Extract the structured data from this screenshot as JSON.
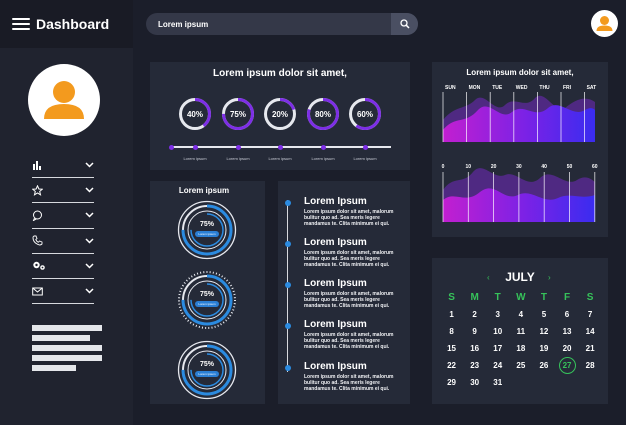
{
  "app": {
    "title": "Dashboard"
  },
  "search": {
    "value": "Lorem ipsum",
    "placeholder": ""
  },
  "sidebar": {
    "items": [
      {
        "icon": "bar-chart-icon"
      },
      {
        "icon": "star-icon"
      },
      {
        "icon": "chat-icon"
      },
      {
        "icon": "phone-icon"
      },
      {
        "icon": "gears-icon"
      },
      {
        "icon": "mail-icon"
      }
    ]
  },
  "progress_panel": {
    "title": "Lorem ipsum dolor sit amet,",
    "rings": [
      {
        "label": "40%",
        "value": 0.4
      },
      {
        "label": "75%",
        "value": 0.75
      },
      {
        "label": "20%",
        "value": 0.2
      },
      {
        "label": "80%",
        "value": 0.8
      },
      {
        "label": "60%",
        "value": 0.6
      }
    ],
    "track_labels": [
      "Lorem ipsum",
      "Lorem ipsum",
      "Lorem ipsum",
      "Lorem ipsum",
      "Lorem ipsum"
    ]
  },
  "gauges_panel": {
    "title": "Lorem ipsum",
    "gauges": [
      {
        "label": "75%",
        "pill": "Lorem ipsum",
        "value": 0.75
      },
      {
        "label": "75%",
        "pill": "Lorem ipsum",
        "value": 0.75
      },
      {
        "label": "75%",
        "pill": "Lorem ipsum",
        "value": 0.75
      }
    ]
  },
  "timeline": {
    "items": [
      {
        "title": "Lorem Ipsum",
        "body": "Lorem ipsum dolor sit amet, malorum bulitur quo ad. Sea meris legere mandamus te. Clita minimum ei qui."
      },
      {
        "title": "Lorem Ipsum",
        "body": "Lorem ipsum dolor sit amet, malorum bulitur quo ad. Sea meris legere mandamus te. Clita minimum ei qui."
      },
      {
        "title": "Lorem Ipsum",
        "body": "Lorem ipsum dolor sit amet, malorum bulitur quo ad. Sea meris legere mandamus te. Clita minimum ei qui."
      },
      {
        "title": "Lorem Ipsum",
        "body": "Lorem ipsum dolor sit amet, malorum bulitur quo ad. Sea meris legere mandamus te. Clita minimum ei qui."
      },
      {
        "title": "Lorem Ipsum",
        "body": "Lorem ipsum dolor sit amet, malorum bulitur quo ad. Sea meris legere mandamus te. Clita minimum ei qui."
      }
    ]
  },
  "wave_panel": {
    "title": "Lorem ipsum dolor sit amet,",
    "days": [
      "SUN",
      "MON",
      "TUE",
      "WED",
      "THU",
      "FRI",
      "SAT"
    ],
    "scale": [
      "0",
      "10",
      "20",
      "30",
      "40",
      "50",
      "60"
    ]
  },
  "calendar": {
    "month": "JULY",
    "weekdays": [
      "S",
      "M",
      "T",
      "W",
      "T",
      "F",
      "S"
    ],
    "days": [
      "1",
      "2",
      "3",
      "4",
      "5",
      "6",
      "7",
      "8",
      "9",
      "10",
      "11",
      "12",
      "13",
      "14",
      "15",
      "16",
      "17",
      "18",
      "19",
      "20",
      "21",
      "22",
      "23",
      "24",
      "25",
      "26",
      "27",
      "28",
      "29",
      "30",
      "31"
    ],
    "today": "27"
  },
  "colors": {
    "bg": "#1b1e2a",
    "panel": "#252a38",
    "accent_purple": "#7d2ee6",
    "accent_blue": "#2b8be0",
    "accent_green": "#36c25a",
    "avatar_orange": "#f39a1e"
  }
}
